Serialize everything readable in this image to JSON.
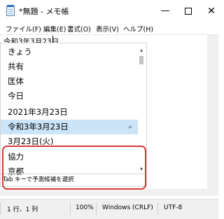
{
  "window": {
    "title": "*無題 - メモ帳",
    "controls": {
      "minimize": "—",
      "maximize": "",
      "close": "✕"
    }
  },
  "menu": [
    "ファイル(F)",
    "編集(E)",
    "書式(O)",
    "表示(V)",
    "ヘルプ(H)"
  ],
  "editor": {
    "text": "令和3年3月23日"
  },
  "candidates": {
    "items": [
      {
        "label": "きょう",
        "selected": false
      },
      {
        "label": "共有",
        "selected": false
      },
      {
        "label": "匡体",
        "selected": false
      },
      {
        "label": "今日",
        "selected": false
      },
      {
        "label": "2021年3月23日",
        "selected": false
      },
      {
        "label": "令和3年3月23日",
        "selected": true
      },
      {
        "label": "3月23日(火)",
        "selected": false
      },
      {
        "label": "協力",
        "selected": false
      },
      {
        "label": "京都",
        "selected": false
      }
    ],
    "search_icon": "magnifier-icon",
    "footer": "Tab キーで予測候補を選択"
  },
  "status": {
    "position": "1 行、1 列",
    "zoom": "100%",
    "line_ending": "Windows (CRLF)",
    "encoding": "UTF-8"
  },
  "colors": {
    "highlight_ring": "#d83a36",
    "selected_row": "#cce4f7"
  }
}
